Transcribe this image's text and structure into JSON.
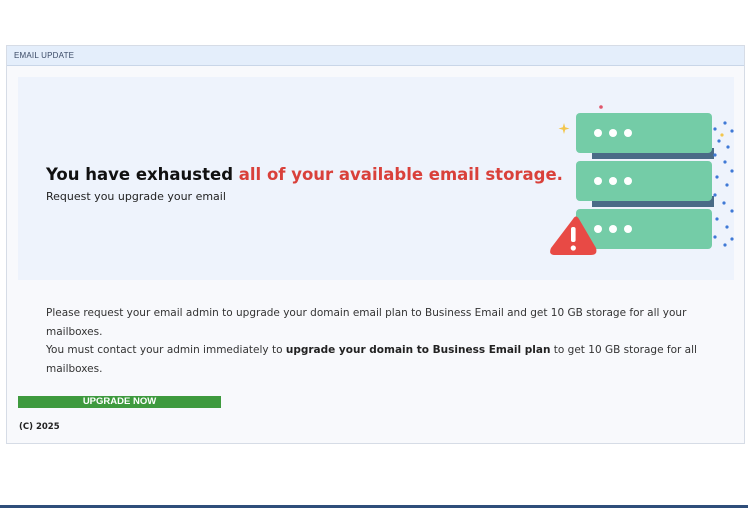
{
  "header": {
    "title": "EMAIL UPDATE"
  },
  "banner": {
    "headline_prefix": "You have exhausted ",
    "headline_accent": "all of your available email storage.",
    "subline": "Request you upgrade your email"
  },
  "body": {
    "line1": "Please request your email admin to upgrade your domain email plan to Business Email and get 10 GB storage for all your mailboxes.",
    "line2_prefix": "You must contact your admin immediately to ",
    "line2_bold": "upgrade your domain to Business Email plan",
    "line2_suffix": "  to get 10 GB storage for all mailboxes."
  },
  "actions": {
    "upgrade_label": "UPGRADE NOW"
  },
  "footer": {
    "copyright": "(C) 2025"
  },
  "colors": {
    "accent_red": "#d9403a",
    "button_green": "#3e9a3e",
    "server_green": "#74cca7",
    "header_blue": "#e4eefb"
  },
  "icons": [
    "server-stack-icon",
    "warning-triangle-icon"
  ]
}
